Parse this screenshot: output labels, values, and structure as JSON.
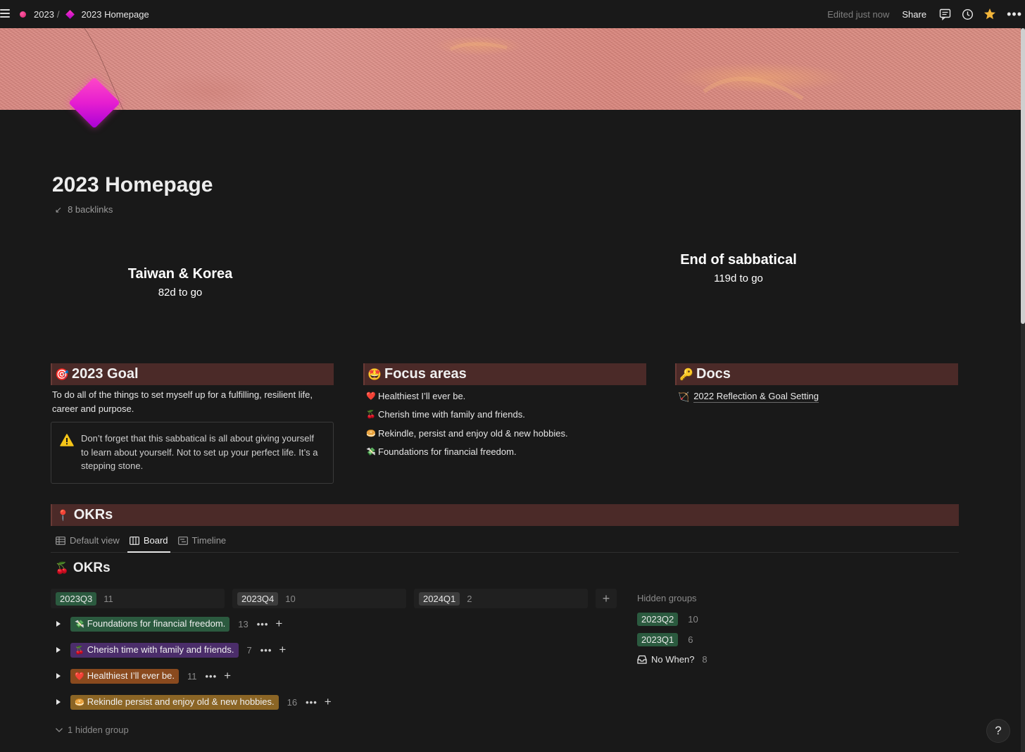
{
  "breadcrumb": {
    "parent": "2023",
    "separator": "/",
    "current": "2023 Homepage"
  },
  "topbar": {
    "edited": "Edited just now",
    "share": "Share",
    "more": "•••"
  },
  "page": {
    "title": "2023 Homepage",
    "backlinks": "8 backlinks"
  },
  "countdowns": [
    {
      "title": "Taiwan & Korea",
      "sub": "82d to go"
    },
    {
      "title": "End of sabbatical",
      "sub": "119d to go"
    }
  ],
  "goal": {
    "emoji": "🎯",
    "title": "2023 Goal",
    "text": "To do all of the things to set myself up for a fulfilling, resilient life, career and purpose.",
    "callout": "Don’t forget that this sabbatical is all about giving yourself to learn about yourself. Not to set up your perfect life. It’s a stepping stone."
  },
  "focus": {
    "emoji": "🤩",
    "title": "Focus areas",
    "items": [
      {
        "emoji": "❤️",
        "label": "Healthiest I’ll ever be."
      },
      {
        "emoji": "🍒",
        "label": "Cherish time with family and friends."
      },
      {
        "emoji": "🥯",
        "label": "Rekindle, persist and enjoy old & new hobbies."
      },
      {
        "emoji": "💸",
        "label": "Foundations for financial freedom."
      }
    ]
  },
  "docs": {
    "emoji": "🔑",
    "title": "Docs",
    "link_icon": "🏹",
    "link": "2022 Reflection & Goal Setting"
  },
  "okrs": {
    "emoji": "📍",
    "title": "OKRs",
    "tabs": [
      "Default view",
      "Board",
      "Timeline"
    ],
    "db_emoji": "🍒",
    "db_title": "OKRs",
    "groups": [
      {
        "label": "2023Q3",
        "count": "11"
      },
      {
        "label": "2023Q4",
        "count": "10"
      },
      {
        "label": "2024Q1",
        "count": "2"
      }
    ],
    "add": "+",
    "rows": [
      {
        "emoji": "💸",
        "label": "Foundations for financial freedom.",
        "count": "13"
      },
      {
        "emoji": "🍒",
        "label": "Cherish time with family and friends.",
        "count": "7"
      },
      {
        "emoji": "❤️",
        "label": "Healthiest I’ll ever be.",
        "count": "11"
      },
      {
        "emoji": "🥯",
        "label": "Rekindle persist and enjoy old & new hobbies.",
        "count": "16"
      }
    ],
    "row_more": "•••",
    "hidden_groups_label": "Hidden groups",
    "hidden_groups": [
      {
        "label": "2023Q2",
        "count": "10"
      },
      {
        "label": "2023Q1",
        "count": "6"
      },
      {
        "label": "No When?",
        "count": "8"
      }
    ],
    "hidden_group_footer": "1 hidden group"
  },
  "help": "?",
  "colors": {
    "background": "#191919",
    "section_header": "#4b2a28",
    "tag_green": "#2b5a3f",
    "tag_purple": "#4b2d6a",
    "tag_orange": "#8a4a1e",
    "tag_brown": "#8b6525",
    "star": "#f2b53a"
  }
}
